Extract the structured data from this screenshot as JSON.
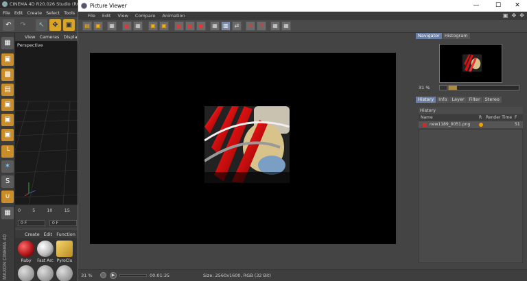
{
  "c4d": {
    "title": "CINEMA 4D R20.026 Studio (RC",
    "menu": [
      "File",
      "Edit",
      "Create",
      "Select",
      "Tools"
    ],
    "viewport_menu": [
      "View",
      "Cameras",
      "Display"
    ],
    "viewport_label": "Perspective",
    "timeline_ticks": [
      "0",
      "5",
      "10",
      "15"
    ],
    "frame_field": "0 F",
    "frame_field2": "0 F",
    "material_menu": [
      "Create",
      "Edit",
      "Function"
    ],
    "materials": [
      {
        "label": "Ruby",
        "color": "#b3161b"
      },
      {
        "label": "Fast Arc",
        "color": "#c9c9c9"
      },
      {
        "label": "PyroClu",
        "color": "#d7b23a"
      }
    ],
    "brand": "MAXON CINEMA 4D"
  },
  "pv": {
    "title": "Picture Viewer",
    "menu": [
      "File",
      "Edit",
      "View",
      "Compare",
      "Animation"
    ],
    "window_buttons": {
      "minimize": "—",
      "maximize": "☐",
      "close": "✕"
    },
    "right_panel": {
      "top_tabs": [
        "Navigator",
        "Histogram"
      ],
      "active_top_tab": "Navigator",
      "zoom": "31 %",
      "zoom_fraction": 0.12,
      "bottom_tabs": [
        "History",
        "Info",
        "Layer",
        "Filter",
        "Stereo"
      ],
      "active_bottom_tab": "History",
      "history_title": "History",
      "history_columns": {
        "name": "Name",
        "r": "R",
        "render_time": "Render Time",
        "f": "F"
      },
      "history_rows": [
        {
          "name": "new1189_0051.png",
          "frame": "51"
        }
      ]
    },
    "status": {
      "zoom": "31 %",
      "time": "00:01:35",
      "info": "Size: 2560x1600, RGB (32 Bit)"
    }
  }
}
